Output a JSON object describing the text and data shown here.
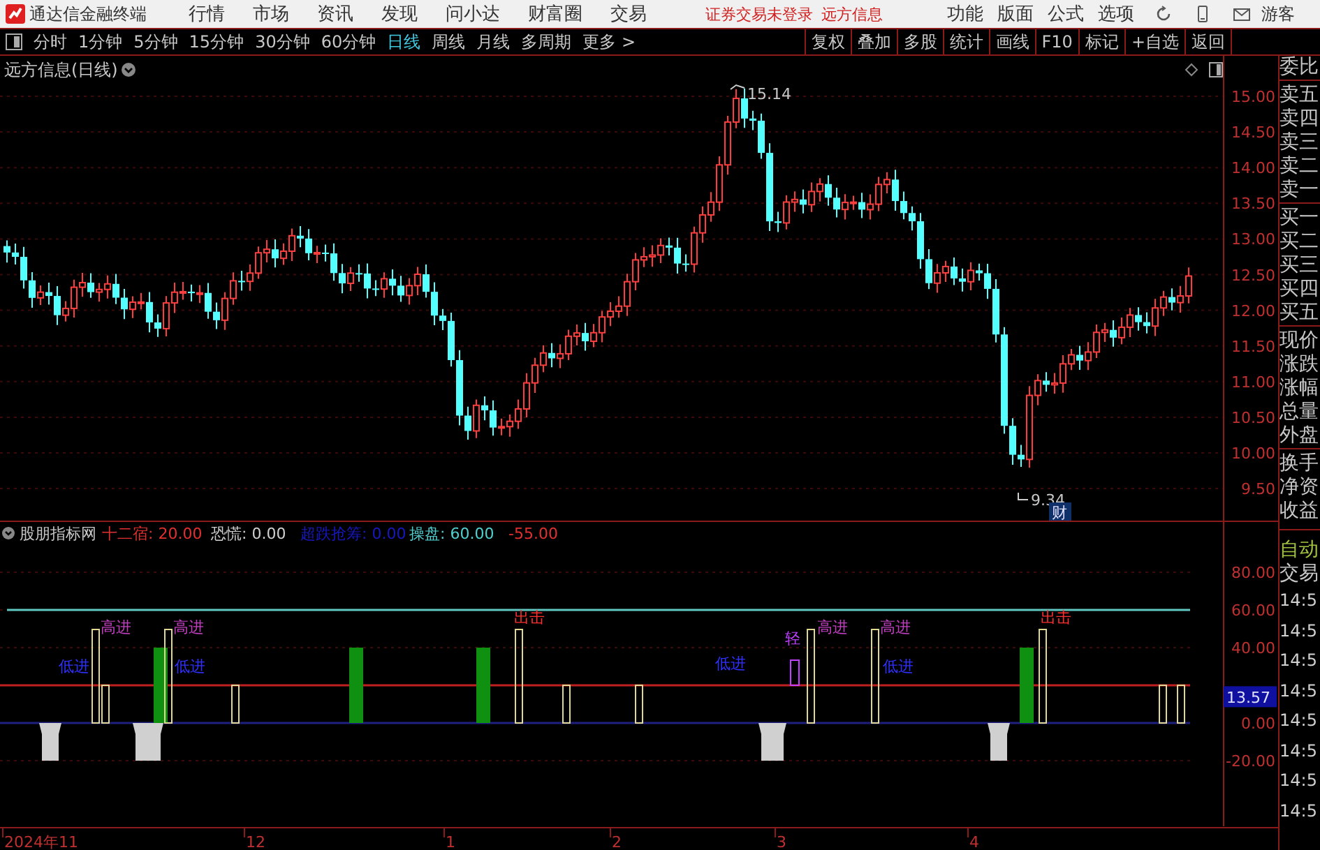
{
  "app": {
    "title": "通达信金融终端",
    "menu": [
      "行情",
      "市场",
      "资讯",
      "发现",
      "问小达",
      "财富圈",
      "交易"
    ],
    "notices": [
      "证券交易未登录",
      "远方信息"
    ],
    "options": [
      "功能",
      "版面",
      "公式",
      "选项"
    ],
    "user": "游客"
  },
  "periods": [
    {
      "label": "分时",
      "selected": false
    },
    {
      "label": "1分钟",
      "selected": false
    },
    {
      "label": "5分钟",
      "selected": false
    },
    {
      "label": "15分钟",
      "selected": false
    },
    {
      "label": "30分钟",
      "selected": false
    },
    {
      "label": "60分钟",
      "selected": false
    },
    {
      "label": "日线",
      "selected": true
    },
    {
      "label": "周线",
      "selected": false
    },
    {
      "label": "月线",
      "selected": false
    },
    {
      "label": "多周期",
      "selected": false
    },
    {
      "label": "更多 >",
      "selected": false
    }
  ],
  "tools": [
    "复权",
    "叠加",
    "多股",
    "统计",
    "画线",
    "F10",
    "标记",
    "+自选",
    "返回"
  ],
  "price_panel": {
    "title": "远方信息(日线)",
    "ticks": [
      "15.00",
      "14.50",
      "14.00",
      "13.50",
      "13.00",
      "12.50",
      "12.00",
      "11.50",
      "11.00",
      "10.50",
      "10.00",
      "9.50"
    ],
    "high_label": "15.14",
    "low_label": "9.34",
    "badge": "财"
  },
  "indicator_panel": {
    "name": "股朋指标网",
    "readouts": [
      {
        "text": "十二宿: 20.00",
        "kind": "primary"
      },
      {
        "text": "恐慌: 0.00",
        "kind": "neutral"
      },
      {
        "text": "超跌抢筹: 0.00",
        "kind": "muted"
      },
      {
        "text": "操盘: 60.00",
        "kind": "accent"
      },
      {
        "text": "-55.00",
        "kind": "negative"
      }
    ],
    "ticks": [
      "80.00",
      "60.00",
      "40.00",
      "0.00",
      "-20.00"
    ],
    "cursor_value": "13.57",
    "signals": [
      {
        "kind": "low",
        "text": "低进"
      },
      {
        "kind": "high",
        "text": "高进"
      },
      {
        "kind": "high",
        "text": "高进"
      },
      {
        "kind": "low",
        "text": "低进"
      },
      {
        "kind": "exit",
        "text": "出击"
      },
      {
        "kind": "low",
        "text": "低进"
      },
      {
        "kind": "light",
        "text": "轻"
      },
      {
        "kind": "high",
        "text": "高进"
      },
      {
        "kind": "low",
        "text": "低进"
      },
      {
        "kind": "high",
        "text": "高进"
      },
      {
        "kind": "exit",
        "text": "出击"
      }
    ]
  },
  "date_axis": [
    "2024年11",
    "12",
    "1",
    "2",
    "3",
    "4"
  ],
  "quote_labels": [
    "委比",
    "卖五",
    "卖四",
    "卖三",
    "卖二",
    "卖一",
    "买一",
    "买二",
    "买三",
    "买四",
    "买五",
    "现价",
    "涨跌",
    "涨幅",
    "总量",
    "外盘",
    "换手",
    "净资",
    "收益"
  ],
  "mode_label": "自动",
  "trade_label": "交易",
  "trade_times": [
    "14:5",
    "14:5",
    "14:5",
    "14:5",
    "14:5",
    "14:5",
    "14:5",
    "14:5"
  ]
}
